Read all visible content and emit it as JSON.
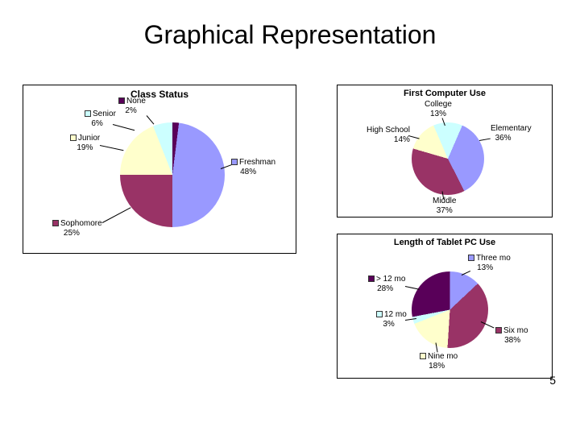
{
  "slide": {
    "title": "Graphical Representation",
    "page_number": "5"
  },
  "chart_data": [
    {
      "type": "pie",
      "title": "Class Status",
      "series": [
        {
          "name": "Freshman",
          "value": 48,
          "label": "Freshman",
          "pct": "48%",
          "color": "#9999ff"
        },
        {
          "name": "Sophomore",
          "value": 25,
          "label": "Sophomore",
          "pct": "25%",
          "color": "#993366"
        },
        {
          "name": "Junior",
          "value": 19,
          "label": "Junior",
          "pct": "19%",
          "color": "#ffffcc"
        },
        {
          "name": "Senior",
          "value": 6,
          "label": "Senior",
          "pct": "6%",
          "color": "#ccffff"
        },
        {
          "name": "None",
          "value": 2,
          "label": "None",
          "pct": "2%",
          "color": "#590059"
        }
      ]
    },
    {
      "type": "pie",
      "title": "First Computer Use",
      "series": [
        {
          "name": "Elementary",
          "value": 36,
          "label": "Elementary",
          "pct": "36%",
          "color": "#9999ff"
        },
        {
          "name": "Middle",
          "value": 37,
          "label": "Middle",
          "pct": "37%",
          "color": "#993366"
        },
        {
          "name": "High School",
          "value": 14,
          "label": "High School",
          "pct": "14%",
          "color": "#ffffcc"
        },
        {
          "name": "College",
          "value": 13,
          "label": "College",
          "pct": "13%",
          "color": "#ccffff"
        }
      ]
    },
    {
      "type": "pie",
      "title": "Length of Tablet PC Use",
      "series": [
        {
          "name": "Three mo",
          "value": 13,
          "label": "Three mo",
          "pct": "13%",
          "color": "#9999ff"
        },
        {
          "name": "Six mo",
          "value": 38,
          "label": "Six  mo",
          "pct": "38%",
          "color": "#993366"
        },
        {
          "name": "Nine mo",
          "value": 18,
          "label": "Nine mo",
          "pct": "18%",
          "color": "#ffffcc"
        },
        {
          "name": "12 mo",
          "value": 3,
          "label": "12 mo",
          "pct": "3%",
          "color": "#ccffff"
        },
        {
          "name": "> 12 mo",
          "value": 28,
          "label": "> 12 mo",
          "pct": "28%",
          "color": "#590059"
        }
      ]
    }
  ]
}
